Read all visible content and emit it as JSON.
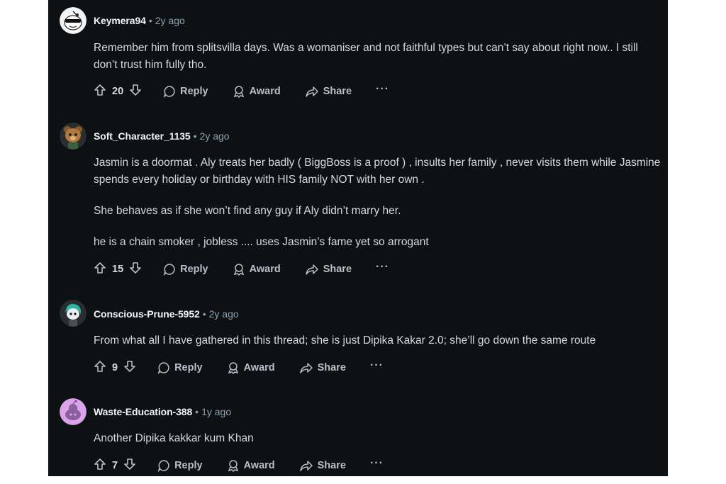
{
  "comments": [
    {
      "username": "Keymera94",
      "age": "2y ago",
      "paragraphs": [
        "Remember him from splitsvilla days. Was a womaniser and not faithful types but can’t say about right now.. I still don’t trust him fully tho."
      ],
      "votes": "20",
      "avatar": "snoo-sunglasses-avatar"
    },
    {
      "username": "Soft_Character_1135",
      "age": "2y ago",
      "paragraphs": [
        "Jasmin is a doormat . Aly treats her badly ( BiggBoss is a proof ) , insults her family , never visits them while Jasmine spends every holiday or birthday with HIS family NOT with her own .",
        "She behaves as if she won’t find any guy if Aly didn’t marry her.",
        "he is a chain smoker , jobless .... uses Jasmin’s fame yet so arrogant"
      ],
      "votes": "15",
      "avatar": "snoo-bear-avatar"
    },
    {
      "username": "Conscious-Prune-5952",
      "age": "2y ago",
      "paragraphs": [
        "From what all I have gathered in this thread; she is just Dipika Kakar 2.0; she’ll go down the same route"
      ],
      "votes": "9",
      "avatar": "snoo-teal-hair-avatar"
    },
    {
      "username": "Waste-Education-388",
      "age": "1y ago",
      "paragraphs": [
        "Another Dipika kakkar kum Khan"
      ],
      "votes": "7",
      "avatar": "snoo-default-pink-avatar"
    }
  ],
  "actions": {
    "reply": "Reply",
    "award": "Award",
    "share": "Share",
    "more": "···"
  },
  "colors": {
    "background": "#0e1113",
    "username": "#f2f4f5",
    "meta": "#8ba2ad",
    "body": "#d7dadc",
    "actions": "#b7c0c6"
  }
}
